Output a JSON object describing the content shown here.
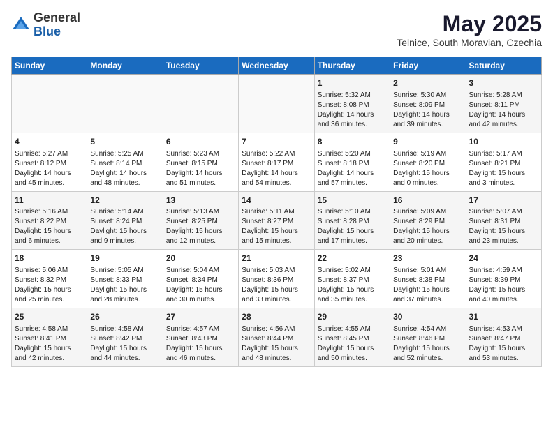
{
  "header": {
    "logo_general": "General",
    "logo_blue": "Blue",
    "title": "May 2025",
    "subtitle": "Telnice, South Moravian, Czechia"
  },
  "calendar": {
    "days_of_week": [
      "Sunday",
      "Monday",
      "Tuesday",
      "Wednesday",
      "Thursday",
      "Friday",
      "Saturday"
    ],
    "weeks": [
      [
        {
          "day": "",
          "info": ""
        },
        {
          "day": "",
          "info": ""
        },
        {
          "day": "",
          "info": ""
        },
        {
          "day": "",
          "info": ""
        },
        {
          "day": "1",
          "info": "Sunrise: 5:32 AM\nSunset: 8:08 PM\nDaylight: 14 hours\nand 36 minutes."
        },
        {
          "day": "2",
          "info": "Sunrise: 5:30 AM\nSunset: 8:09 PM\nDaylight: 14 hours\nand 39 minutes."
        },
        {
          "day": "3",
          "info": "Sunrise: 5:28 AM\nSunset: 8:11 PM\nDaylight: 14 hours\nand 42 minutes."
        }
      ],
      [
        {
          "day": "4",
          "info": "Sunrise: 5:27 AM\nSunset: 8:12 PM\nDaylight: 14 hours\nand 45 minutes."
        },
        {
          "day": "5",
          "info": "Sunrise: 5:25 AM\nSunset: 8:14 PM\nDaylight: 14 hours\nand 48 minutes."
        },
        {
          "day": "6",
          "info": "Sunrise: 5:23 AM\nSunset: 8:15 PM\nDaylight: 14 hours\nand 51 minutes."
        },
        {
          "day": "7",
          "info": "Sunrise: 5:22 AM\nSunset: 8:17 PM\nDaylight: 14 hours\nand 54 minutes."
        },
        {
          "day": "8",
          "info": "Sunrise: 5:20 AM\nSunset: 8:18 PM\nDaylight: 14 hours\nand 57 minutes."
        },
        {
          "day": "9",
          "info": "Sunrise: 5:19 AM\nSunset: 8:20 PM\nDaylight: 15 hours\nand 0 minutes."
        },
        {
          "day": "10",
          "info": "Sunrise: 5:17 AM\nSunset: 8:21 PM\nDaylight: 15 hours\nand 3 minutes."
        }
      ],
      [
        {
          "day": "11",
          "info": "Sunrise: 5:16 AM\nSunset: 8:22 PM\nDaylight: 15 hours\nand 6 minutes."
        },
        {
          "day": "12",
          "info": "Sunrise: 5:14 AM\nSunset: 8:24 PM\nDaylight: 15 hours\nand 9 minutes."
        },
        {
          "day": "13",
          "info": "Sunrise: 5:13 AM\nSunset: 8:25 PM\nDaylight: 15 hours\nand 12 minutes."
        },
        {
          "day": "14",
          "info": "Sunrise: 5:11 AM\nSunset: 8:27 PM\nDaylight: 15 hours\nand 15 minutes."
        },
        {
          "day": "15",
          "info": "Sunrise: 5:10 AM\nSunset: 8:28 PM\nDaylight: 15 hours\nand 17 minutes."
        },
        {
          "day": "16",
          "info": "Sunrise: 5:09 AM\nSunset: 8:29 PM\nDaylight: 15 hours\nand 20 minutes."
        },
        {
          "day": "17",
          "info": "Sunrise: 5:07 AM\nSunset: 8:31 PM\nDaylight: 15 hours\nand 23 minutes."
        }
      ],
      [
        {
          "day": "18",
          "info": "Sunrise: 5:06 AM\nSunset: 8:32 PM\nDaylight: 15 hours\nand 25 minutes."
        },
        {
          "day": "19",
          "info": "Sunrise: 5:05 AM\nSunset: 8:33 PM\nDaylight: 15 hours\nand 28 minutes."
        },
        {
          "day": "20",
          "info": "Sunrise: 5:04 AM\nSunset: 8:34 PM\nDaylight: 15 hours\nand 30 minutes."
        },
        {
          "day": "21",
          "info": "Sunrise: 5:03 AM\nSunset: 8:36 PM\nDaylight: 15 hours\nand 33 minutes."
        },
        {
          "day": "22",
          "info": "Sunrise: 5:02 AM\nSunset: 8:37 PM\nDaylight: 15 hours\nand 35 minutes."
        },
        {
          "day": "23",
          "info": "Sunrise: 5:01 AM\nSunset: 8:38 PM\nDaylight: 15 hours\nand 37 minutes."
        },
        {
          "day": "24",
          "info": "Sunrise: 4:59 AM\nSunset: 8:39 PM\nDaylight: 15 hours\nand 40 minutes."
        }
      ],
      [
        {
          "day": "25",
          "info": "Sunrise: 4:58 AM\nSunset: 8:41 PM\nDaylight: 15 hours\nand 42 minutes."
        },
        {
          "day": "26",
          "info": "Sunrise: 4:58 AM\nSunset: 8:42 PM\nDaylight: 15 hours\nand 44 minutes."
        },
        {
          "day": "27",
          "info": "Sunrise: 4:57 AM\nSunset: 8:43 PM\nDaylight: 15 hours\nand 46 minutes."
        },
        {
          "day": "28",
          "info": "Sunrise: 4:56 AM\nSunset: 8:44 PM\nDaylight: 15 hours\nand 48 minutes."
        },
        {
          "day": "29",
          "info": "Sunrise: 4:55 AM\nSunset: 8:45 PM\nDaylight: 15 hours\nand 50 minutes."
        },
        {
          "day": "30",
          "info": "Sunrise: 4:54 AM\nSunset: 8:46 PM\nDaylight: 15 hours\nand 52 minutes."
        },
        {
          "day": "31",
          "info": "Sunrise: 4:53 AM\nSunset: 8:47 PM\nDaylight: 15 hours\nand 53 minutes."
        }
      ]
    ]
  }
}
